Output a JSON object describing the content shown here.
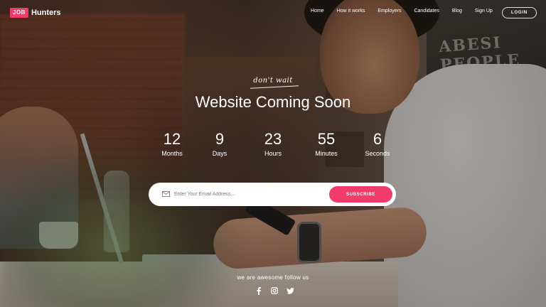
{
  "brand": {
    "badge": "JOB",
    "name": "Hunters"
  },
  "nav": {
    "items": [
      {
        "label": "Home"
      },
      {
        "label": "How it works"
      },
      {
        "label": "Employers"
      },
      {
        "label": "Candidates"
      },
      {
        "label": "Blog"
      },
      {
        "label": "Sign Up"
      }
    ],
    "login_label": "LOGIN"
  },
  "hero": {
    "tagline": "don't wait",
    "title": "Website Coming Soon"
  },
  "countdown": [
    {
      "value": "12",
      "label": "Months"
    },
    {
      "value": "9",
      "label": "Days"
    },
    {
      "value": "23",
      "label": "Hours"
    },
    {
      "value": "55",
      "label": "Minutes"
    },
    {
      "value": "6",
      "label": "Seconds"
    }
  ],
  "subscribe": {
    "placeholder": "Enter Your Email Address...",
    "button_label": "SUBSCRIBE"
  },
  "footer": {
    "follow_text": "we are awesome follow us",
    "socials": [
      "facebook-icon",
      "instagram-icon",
      "twitter-icon"
    ]
  },
  "colors": {
    "accent": "#f13c6b",
    "text": "#ffffff"
  }
}
